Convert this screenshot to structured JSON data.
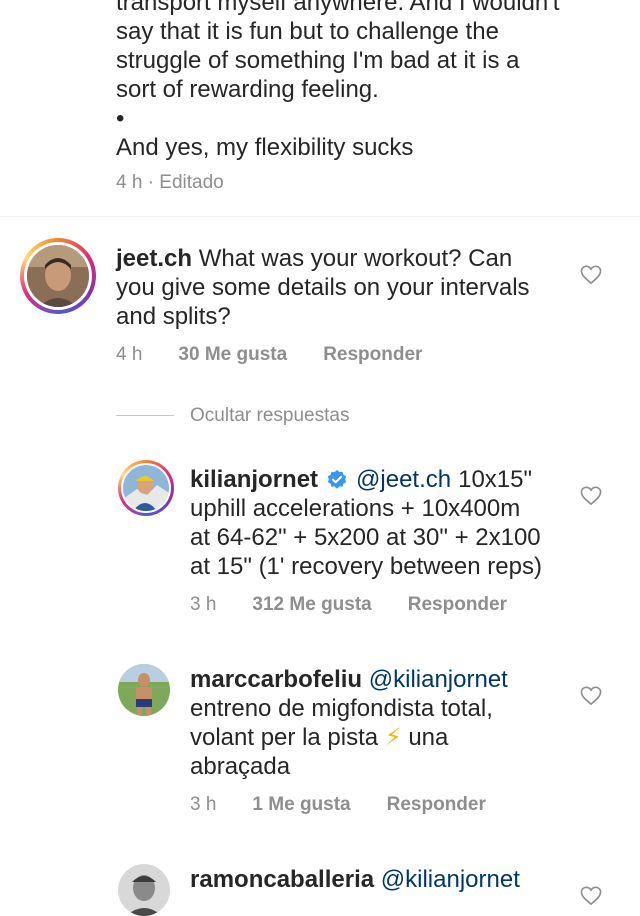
{
  "top_comment": {
    "lines": [
      "transport myself anywhere. And I wouldn't",
      "say that it is fun but to challenge the",
      "struggle of something I'm bad at it is a",
      "sort of rewarding feeling.",
      "•",
      "And yes, my flexibility sucks"
    ],
    "meta": "4 h · Editado"
  },
  "comments": [
    {
      "username": "jeet.ch",
      "text_first": "What was your workout? Can",
      "lines": [
        "you give some details on your intervals",
        "and splits?"
      ],
      "time": "4 h",
      "likes": "30 Me gusta",
      "reply": "Responder"
    }
  ],
  "replies_toggle": "Ocultar respuestas",
  "replies": [
    {
      "username": "kilianjornet",
      "verified": true,
      "mention": "@jeet.ch",
      "text_first": "10x15\"",
      "lines": [
        "uphill accelerations + 10x400m",
        "at 64-62\" + 5x200 at 30\" + 2x100",
        "at 15\" (1' recovery between reps)"
      ],
      "time": "3 h",
      "likes": "312 Me gusta",
      "reply": "Responder"
    },
    {
      "username": "marccarbofeliu",
      "mention": "@kilianjornet",
      "lines": [
        "entreno de migfondista total,",
        "volant per la pista",
        "una",
        "abraçada"
      ],
      "emoji": "⚡",
      "time": "3 h",
      "likes": "1 Me gusta",
      "reply": "Responder"
    },
    {
      "username": "ramoncaballeria",
      "mention": "@kilianjornet"
    }
  ],
  "colors": {
    "text": "#262626",
    "secondary": "#8e8e8e",
    "mention": "#00376b",
    "verified": "#3897f0"
  }
}
